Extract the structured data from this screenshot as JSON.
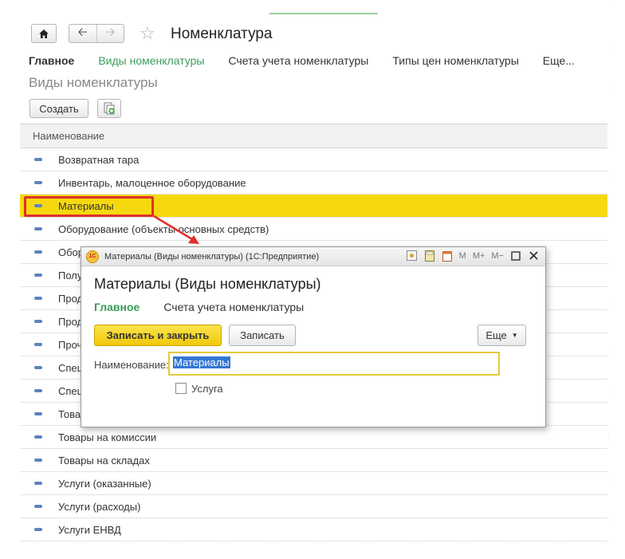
{
  "window": {
    "title": "Номенклатура"
  },
  "tabs": [
    {
      "label": "Главное"
    },
    {
      "label": "Виды номенклатуры"
    },
    {
      "label": "Счета учета номенклатуры"
    },
    {
      "label": "Типы цен номенклатуры"
    },
    {
      "label": "Еще..."
    }
  ],
  "section": {
    "title": "Виды номенклатуры"
  },
  "toolbar": {
    "create_label": "Создать"
  },
  "list": {
    "column_header": "Наименование",
    "selected_index": 2,
    "rows": [
      {
        "name": "Возвратная тара"
      },
      {
        "name": "Инвентарь, малоценное оборудование"
      },
      {
        "name": "Материалы"
      },
      {
        "name": "Оборудование (объекты основных средств)"
      },
      {
        "name": "Обор"
      },
      {
        "name": "Полу"
      },
      {
        "name": "Прод"
      },
      {
        "name": "Прод"
      },
      {
        "name": "Проч"
      },
      {
        "name": "Спец"
      },
      {
        "name": "Спец"
      },
      {
        "name": "Това"
      },
      {
        "name": "Товары на комиссии"
      },
      {
        "name": "Товары на складах"
      },
      {
        "name": "Услуги (оказанные)"
      },
      {
        "name": "Услуги (расходы)"
      },
      {
        "name": "Услуги ЕНВД"
      }
    ]
  },
  "dialog": {
    "window_title": "Материалы (Виды номенклатуры)  (1С:Предприятие)",
    "logo_text": "1С",
    "header": "Материалы (Виды номенклатуры)",
    "tabs": [
      {
        "label": "Главное"
      },
      {
        "label": "Счета учета номенклатуры"
      }
    ],
    "save_close_label": "Записать и закрыть",
    "save_label": "Записать",
    "more_label": "Еще",
    "name_label": "Наименование:",
    "name_value": "Материалы",
    "service_label": "Услуга",
    "service_checked": false,
    "titlebar_buttons": [
      "M",
      "M+",
      "M−"
    ]
  },
  "colors": {
    "accent_green": "#3c9b5a",
    "selection_yellow": "#f5d90e",
    "highlight_red": "#e0302c"
  }
}
